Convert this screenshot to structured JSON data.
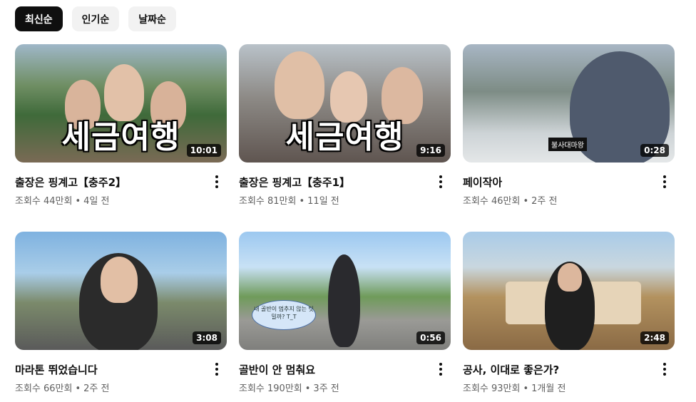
{
  "filters": [
    "최신순",
    "인기순",
    "날짜순"
  ],
  "active_filter_index": 0,
  "videos": [
    {
      "title": "출장은 핑계고【충주2】",
      "views": "조회수 44만회",
      "age": "4일 전",
      "duration": "10:01",
      "overlay": "세금여행"
    },
    {
      "title": "출장은 핑계고【충주1】",
      "views": "조회수 81만회",
      "age": "11일 전",
      "duration": "9:16",
      "overlay": "세금여행"
    },
    {
      "title": "페이작아",
      "views": "조회수 46만회",
      "age": "2주 전",
      "duration": "0:28",
      "caption": "불사대마왕"
    },
    {
      "title": "마라톤 뛰었습니다",
      "views": "조회수 66만회",
      "age": "2주 전",
      "duration": "3:08"
    },
    {
      "title": "골반이 안 멈춰요",
      "views": "조회수 190만회",
      "age": "3주 전",
      "duration": "0:56",
      "bubble": "내 골반이 멈추지 않는 팃밀까? T_T"
    },
    {
      "title": "공사, 이대로 좋은가?",
      "views": "조회수 93만회",
      "age": "1개월 전",
      "duration": "2:48"
    }
  ]
}
